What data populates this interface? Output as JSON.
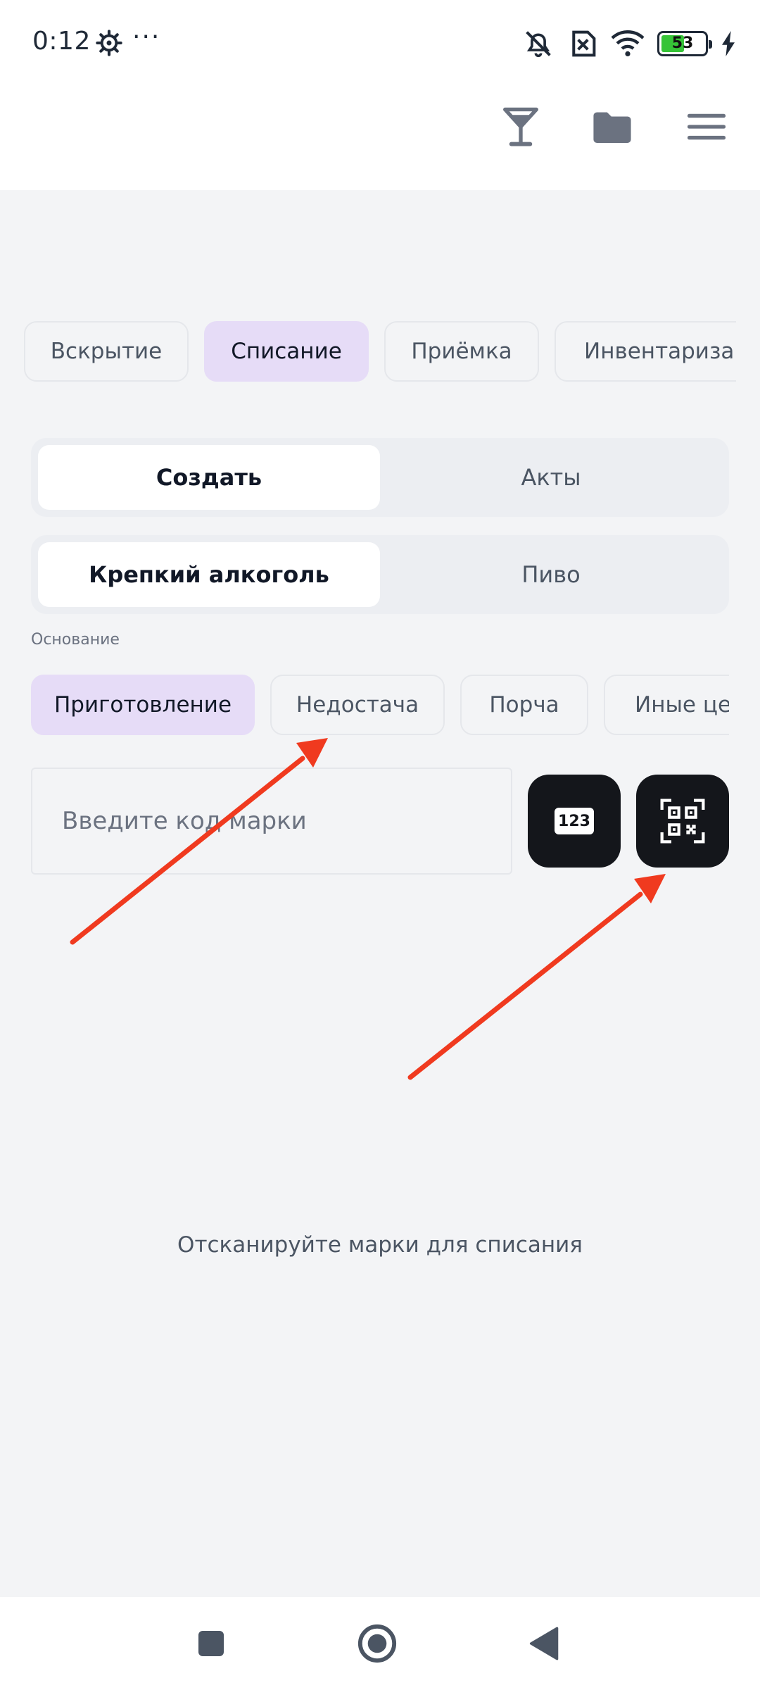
{
  "status_bar": {
    "time": "0:12",
    "dots": "···",
    "battery_level": "53",
    "battery_color": "#36c437",
    "icons": [
      "gear-icon",
      "mute-icon",
      "sim-blocked-icon",
      "wifi-icon",
      "battery-icon",
      "charging-icon"
    ]
  },
  "header": {
    "icons": [
      "cocktail-glass-icon",
      "folder-icon",
      "hamburger-menu-icon"
    ]
  },
  "category_tabs": [
    {
      "label": "Вскрытие",
      "active": false
    },
    {
      "label": "Списание",
      "active": true
    },
    {
      "label": "Приёмка",
      "active": false
    },
    {
      "label": "Инвентаризац",
      "active": false
    }
  ],
  "action_segment": [
    {
      "label": "Создать",
      "active": true
    },
    {
      "label": "Акты",
      "active": false
    }
  ],
  "type_segment": [
    {
      "label": "Крепкий алкоголь",
      "active": true
    },
    {
      "label": "Пиво",
      "active": false
    }
  ],
  "basis": {
    "label": "Основание",
    "options": [
      {
        "label": "Приготовление",
        "active": true
      },
      {
        "label": "Недостача",
        "active": false
      },
      {
        "label": "Порча",
        "active": false
      },
      {
        "label": "Иные цел",
        "active": false
      }
    ]
  },
  "code_input": {
    "placeholder": "Введите код марки",
    "value": ""
  },
  "numeric_button": {
    "badge": "123"
  },
  "empty_state": "Отсканируйте марки для списания",
  "colors": {
    "accent_chip": "#e6dcf7",
    "dark_button": "#14161b",
    "arrow": "#f03a1f"
  }
}
